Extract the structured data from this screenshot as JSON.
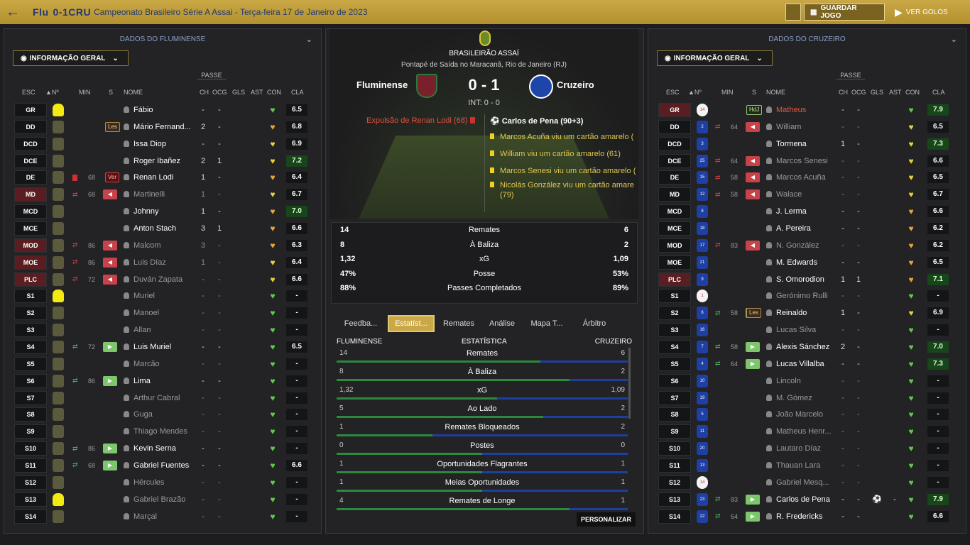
{
  "top": {
    "home_abbr": "Flu",
    "score": "0-1",
    "away_abbr": "CRU",
    "competition": "Campeonato Brasileiro Série A Assai - Terça-feira 17 de Janeiro de 2023",
    "save_label": "GUARDAR JOGO",
    "watch_label": "VER GOLOS"
  },
  "left": {
    "title": "DADOS DO FLUMINENSE",
    "info_label": "INFORMAÇÃO GERAL",
    "passe": "PASSE",
    "headers": {
      "esc": "ESC",
      "num": "Nº",
      "min": "MIN",
      "s": "S",
      "nome": "NOME",
      "ch": "CH",
      "ocg": "OCG",
      "gls": "GLS",
      "ast": "AST",
      "con": "CON",
      "cla": "CLA"
    },
    "players": [
      {
        "pos": "GR",
        "shirt": "y",
        "badge": "",
        "sub": "",
        "min": "",
        "name": "Fábio",
        "dim": false,
        "ch": "-",
        "ocg": "-",
        "gls": "",
        "ast": "",
        "con": "green",
        "cla": "6.5",
        "good": false
      },
      {
        "pos": "DD",
        "shirt": "n",
        "badge": "Les",
        "sub": "",
        "min": "",
        "name": "Mário Fernand...",
        "dim": false,
        "ch": "2",
        "ocg": "-",
        "gls": "",
        "ast": "",
        "con": "orange",
        "cla": "6.8",
        "good": false
      },
      {
        "pos": "DCD",
        "shirt": "n",
        "badge": "",
        "sub": "",
        "min": "",
        "name": "Issa Diop",
        "dim": false,
        "ch": "-",
        "ocg": "-",
        "gls": "",
        "ast": "",
        "con": "yellow",
        "cla": "6.9",
        "good": false
      },
      {
        "pos": "DCE",
        "shirt": "n",
        "badge": "",
        "sub": "",
        "min": "",
        "name": "Roger Ibañez",
        "dim": false,
        "ch": "2",
        "ocg": "1",
        "gls": "",
        "ast": "",
        "con": "yellow",
        "cla": "7.2",
        "good": true
      },
      {
        "pos": "DE",
        "shirt": "n",
        "badge": "Ver",
        "sub": "card",
        "min": "68",
        "name": "Renan Lodi",
        "dim": false,
        "ch": "1",
        "ocg": "-",
        "gls": "",
        "ast": "",
        "con": "orange",
        "cla": "6.4",
        "good": false
      },
      {
        "pos": "MD",
        "shirt": "n",
        "badge": "",
        "sub": "out",
        "min": "68",
        "name": "Martinelli",
        "dim": true,
        "ch": "1",
        "ocg": "-",
        "gls": "",
        "ast": "",
        "con": "yellow",
        "cla": "6.7",
        "good": false
      },
      {
        "pos": "MCD",
        "shirt": "n",
        "badge": "",
        "sub": "",
        "min": "",
        "name": "Johnny",
        "dim": false,
        "ch": "1",
        "ocg": "-",
        "gls": "",
        "ast": "",
        "con": "orange",
        "cla": "7.0",
        "good": true
      },
      {
        "pos": "MCE",
        "shirt": "n",
        "badge": "",
        "sub": "",
        "min": "",
        "name": "Anton Stach",
        "dim": false,
        "ch": "3",
        "ocg": "1",
        "gls": "",
        "ast": "",
        "con": "orange",
        "cla": "6.6",
        "good": false
      },
      {
        "pos": "MOD",
        "shirt": "n",
        "badge": "",
        "sub": "out",
        "min": "86",
        "name": "Malcom",
        "dim": true,
        "ch": "3",
        "ocg": "-",
        "gls": "",
        "ast": "",
        "con": "orange",
        "cla": "6.3",
        "good": false
      },
      {
        "pos": "MOE",
        "shirt": "n",
        "badge": "",
        "sub": "out",
        "min": "86",
        "name": "Luis Díaz",
        "dim": true,
        "ch": "1",
        "ocg": "-",
        "gls": "",
        "ast": "",
        "con": "yellow",
        "cla": "6.4",
        "good": false
      },
      {
        "pos": "PLC",
        "shirt": "n",
        "badge": "",
        "sub": "out",
        "min": "72",
        "name": "Duván Zapata",
        "dim": true,
        "ch": "-",
        "ocg": "-",
        "gls": "",
        "ast": "",
        "con": "yellow",
        "cla": "6.6",
        "good": false
      },
      {
        "pos": "S1",
        "shirt": "y",
        "badge": "",
        "sub": "",
        "min": "",
        "name": "Muriel",
        "dim": true,
        "ch": "-",
        "ocg": "-",
        "gls": "",
        "ast": "",
        "con": "green",
        "cla": "-",
        "good": false
      },
      {
        "pos": "S2",
        "shirt": "n",
        "badge": "",
        "sub": "",
        "min": "",
        "name": "Manoel",
        "dim": true,
        "ch": "-",
        "ocg": "-",
        "gls": "",
        "ast": "",
        "con": "green",
        "cla": "-",
        "good": false
      },
      {
        "pos": "S3",
        "shirt": "n",
        "badge": "",
        "sub": "",
        "min": "",
        "name": "Allan",
        "dim": true,
        "ch": "-",
        "ocg": "-",
        "gls": "",
        "ast": "",
        "con": "green",
        "cla": "-",
        "good": false
      },
      {
        "pos": "S4",
        "shirt": "n",
        "badge": "",
        "sub": "in",
        "min": "72",
        "name": "Luis Muriel",
        "dim": false,
        "ch": "-",
        "ocg": "-",
        "gls": "",
        "ast": "",
        "con": "green",
        "cla": "6.5",
        "good": false
      },
      {
        "pos": "S5",
        "shirt": "n",
        "badge": "",
        "sub": "",
        "min": "",
        "name": "Marcão",
        "dim": true,
        "ch": "-",
        "ocg": "-",
        "gls": "",
        "ast": "",
        "con": "green",
        "cla": "-",
        "good": false
      },
      {
        "pos": "S6",
        "shirt": "n",
        "badge": "",
        "sub": "in",
        "min": "86",
        "name": "Lima",
        "dim": false,
        "ch": "-",
        "ocg": "-",
        "gls": "",
        "ast": "",
        "con": "green",
        "cla": "-",
        "good": false
      },
      {
        "pos": "S7",
        "shirt": "n",
        "badge": "",
        "sub": "",
        "min": "",
        "name": "Arthur Cabral",
        "dim": true,
        "ch": "-",
        "ocg": "-",
        "gls": "",
        "ast": "",
        "con": "green",
        "cla": "-",
        "good": false
      },
      {
        "pos": "S8",
        "shirt": "n",
        "badge": "",
        "sub": "",
        "min": "",
        "name": "Guga",
        "dim": true,
        "ch": "-",
        "ocg": "-",
        "gls": "",
        "ast": "",
        "con": "green",
        "cla": "-",
        "good": false
      },
      {
        "pos": "S9",
        "shirt": "n",
        "badge": "",
        "sub": "",
        "min": "",
        "name": "Thiago Mendes",
        "dim": true,
        "ch": "-",
        "ocg": "-",
        "gls": "",
        "ast": "",
        "con": "green",
        "cla": "-",
        "good": false
      },
      {
        "pos": "S10",
        "shirt": "n",
        "badge": "",
        "sub": "in",
        "min": "86",
        "name": "Kevin Serna",
        "dim": false,
        "ch": "-",
        "ocg": "-",
        "gls": "",
        "ast": "",
        "con": "green",
        "cla": "-",
        "good": false
      },
      {
        "pos": "S11",
        "shirt": "n",
        "badge": "",
        "sub": "in",
        "min": "68",
        "name": "Gabriel Fuentes",
        "dim": false,
        "ch": "-",
        "ocg": "-",
        "gls": "",
        "ast": "",
        "con": "green",
        "cla": "6.6",
        "good": false
      },
      {
        "pos": "S12",
        "shirt": "n",
        "badge": "",
        "sub": "",
        "min": "",
        "name": "Hércules",
        "dim": true,
        "ch": "-",
        "ocg": "-",
        "gls": "",
        "ast": "",
        "con": "green",
        "cla": "-",
        "good": false
      },
      {
        "pos": "S13",
        "shirt": "y",
        "badge": "",
        "sub": "",
        "min": "",
        "name": "Gabriel Brazão",
        "dim": true,
        "ch": "-",
        "ocg": "-",
        "gls": "",
        "ast": "",
        "con": "green",
        "cla": "-",
        "good": false
      },
      {
        "pos": "S14",
        "shirt": "n",
        "badge": "",
        "sub": "",
        "min": "",
        "name": "Marçal",
        "dim": true,
        "ch": "-",
        "ocg": "-",
        "gls": "",
        "ast": "",
        "con": "green",
        "cla": "-",
        "good": false
      }
    ]
  },
  "right": {
    "title": "DADOS DO CRUZEIRO",
    "info_label": "INFORMAÇÃO GERAL",
    "passe": "PASSE",
    "headers": {
      "esc": "ESC",
      "num": "Nº",
      "min": "MIN",
      "s": "S",
      "nome": "NOME",
      "ch": "CH",
      "ocg": "OCG",
      "gls": "GLS",
      "ast": "AST",
      "con": "CON",
      "cla": "CLA"
    },
    "players": [
      {
        "pos": "GR",
        "shirt": "w",
        "num": "14",
        "badge": "HdJ",
        "sub": "",
        "min": "",
        "name": "Matheus",
        "dim": false,
        "red": true,
        "ch": "-",
        "ocg": "-",
        "gls": "",
        "ast": "",
        "con": "green",
        "cla": "7.9",
        "good": true
      },
      {
        "pos": "DD",
        "shirt": "b",
        "num": "2",
        "badge": "",
        "sub": "out",
        "min": "64",
        "name": "William",
        "dim": true,
        "ch": "-",
        "ocg": "-",
        "gls": "",
        "ast": "",
        "con": "yellow",
        "cla": "6.5",
        "good": false
      },
      {
        "pos": "DCD",
        "shirt": "b",
        "num": "3",
        "badge": "",
        "sub": "",
        "min": "",
        "name": "Tormena",
        "dim": false,
        "ch": "1",
        "ocg": "-",
        "gls": "",
        "ast": "",
        "con": "yellow",
        "cla": "7.3",
        "good": true
      },
      {
        "pos": "DCE",
        "shirt": "b",
        "num": "25",
        "badge": "",
        "sub": "out",
        "min": "64",
        "name": "Marcos Senesi",
        "dim": true,
        "ch": "-",
        "ocg": "-",
        "gls": "",
        "ast": "",
        "con": "yellow",
        "cla": "6.6",
        "good": false
      },
      {
        "pos": "DE",
        "shirt": "b",
        "num": "15",
        "badge": "",
        "sub": "out",
        "min": "58",
        "name": "Marcos Acuña",
        "dim": true,
        "ch": "-",
        "ocg": "-",
        "gls": "",
        "ast": "",
        "con": "yellow",
        "cla": "6.5",
        "good": false
      },
      {
        "pos": "MD",
        "shirt": "b",
        "num": "12",
        "badge": "",
        "sub": "out",
        "min": "58",
        "name": "Walace",
        "dim": true,
        "ch": "-",
        "ocg": "-",
        "gls": "",
        "ast": "",
        "con": "yellow",
        "cla": "6.7",
        "good": false
      },
      {
        "pos": "MCD",
        "shirt": "b",
        "num": "8",
        "badge": "",
        "sub": "",
        "min": "",
        "name": "J. Lerma",
        "dim": false,
        "ch": "-",
        "ocg": "-",
        "gls": "",
        "ast": "",
        "con": "orange",
        "cla": "6.6",
        "good": false
      },
      {
        "pos": "MCE",
        "shirt": "b",
        "num": "18",
        "badge": "",
        "sub": "",
        "min": "",
        "name": "A. Pereira",
        "dim": false,
        "ch": "-",
        "ocg": "-",
        "gls": "",
        "ast": "",
        "con": "orange",
        "cla": "6.2",
        "good": false
      },
      {
        "pos": "MOD",
        "shirt": "b",
        "num": "17",
        "badge": "",
        "sub": "out",
        "min": "83",
        "name": "N. González",
        "dim": true,
        "ch": "-",
        "ocg": "-",
        "gls": "",
        "ast": "",
        "con": "orange",
        "cla": "6.2",
        "good": false
      },
      {
        "pos": "MOE",
        "shirt": "b",
        "num": "21",
        "badge": "",
        "sub": "",
        "min": "",
        "name": "M. Edwards",
        "dim": false,
        "ch": "-",
        "ocg": "-",
        "gls": "",
        "ast": "",
        "con": "orange",
        "cla": "6.5",
        "good": false
      },
      {
        "pos": "PLC",
        "shirt": "b",
        "num": "9",
        "badge": "",
        "sub": "",
        "min": "",
        "name": "S. Omorodion",
        "dim": false,
        "ch": "1",
        "ocg": "1",
        "gls": "",
        "ast": "",
        "con": "orange",
        "cla": "7.1",
        "good": true
      },
      {
        "pos": "S1",
        "shirt": "w",
        "num": "1",
        "badge": "",
        "sub": "",
        "min": "",
        "name": "Gerónimo Rulli",
        "dim": true,
        "ch": "-",
        "ocg": "-",
        "gls": "",
        "ast": "",
        "con": "green",
        "cla": "-",
        "good": false
      },
      {
        "pos": "S2",
        "shirt": "b",
        "num": "6",
        "badge": "Les",
        "sub": "in",
        "min": "58",
        "name": "Reinaldo",
        "dim": false,
        "ch": "1",
        "ocg": "-",
        "gls": "",
        "ast": "",
        "con": "yellow",
        "cla": "6.9",
        "good": false
      },
      {
        "pos": "S3",
        "shirt": "b",
        "num": "16",
        "badge": "",
        "sub": "",
        "min": "",
        "name": "Lucas Silva",
        "dim": true,
        "ch": "-",
        "ocg": "-",
        "gls": "",
        "ast": "",
        "con": "green",
        "cla": "-",
        "good": false
      },
      {
        "pos": "S4",
        "shirt": "b",
        "num": "7",
        "badge": "",
        "sub": "in",
        "min": "58",
        "name": "Alexis Sánchez",
        "dim": false,
        "ch": "2",
        "ocg": "-",
        "gls": "",
        "ast": "",
        "con": "green",
        "cla": "7.0",
        "good": true
      },
      {
        "pos": "S5",
        "shirt": "b",
        "num": "4",
        "badge": "",
        "sub": "in",
        "min": "64",
        "name": "Lucas Villalba",
        "dim": false,
        "ch": "-",
        "ocg": "-",
        "gls": "",
        "ast": "",
        "con": "green",
        "cla": "7.3",
        "good": true
      },
      {
        "pos": "S6",
        "shirt": "b",
        "num": "10",
        "badge": "",
        "sub": "",
        "min": "",
        "name": "Lincoln",
        "dim": true,
        "ch": "-",
        "ocg": "-",
        "gls": "",
        "ast": "",
        "con": "green",
        "cla": "-",
        "good": false
      },
      {
        "pos": "S7",
        "shirt": "b",
        "num": "19",
        "badge": "",
        "sub": "",
        "min": "",
        "name": "M. Gómez",
        "dim": true,
        "ch": "-",
        "ocg": "-",
        "gls": "",
        "ast": "",
        "con": "green",
        "cla": "-",
        "good": false
      },
      {
        "pos": "S8",
        "shirt": "b",
        "num": "5",
        "badge": "",
        "sub": "",
        "min": "",
        "name": "João Marcelo",
        "dim": true,
        "ch": "-",
        "ocg": "-",
        "gls": "",
        "ast": "",
        "con": "green",
        "cla": "-",
        "good": false
      },
      {
        "pos": "S9",
        "shirt": "b",
        "num": "11",
        "badge": "",
        "sub": "",
        "min": "",
        "name": "Matheus Henr...",
        "dim": true,
        "ch": "-",
        "ocg": "-",
        "gls": "",
        "ast": "",
        "con": "green",
        "cla": "-",
        "good": false
      },
      {
        "pos": "S10",
        "shirt": "b",
        "num": "20",
        "badge": "",
        "sub": "",
        "min": "",
        "name": "Lautaro Díaz",
        "dim": true,
        "ch": "-",
        "ocg": "-",
        "gls": "",
        "ast": "",
        "con": "green",
        "cla": "-",
        "good": false
      },
      {
        "pos": "S11",
        "shirt": "b",
        "num": "13",
        "badge": "",
        "sub": "",
        "min": "",
        "name": "Thauan Lara",
        "dim": true,
        "ch": "-",
        "ocg": "-",
        "gls": "",
        "ast": "",
        "con": "green",
        "cla": "-",
        "good": false
      },
      {
        "pos": "S12",
        "shirt": "w",
        "num": "14",
        "badge": "",
        "sub": "",
        "min": "",
        "name": "Gabriel Mesq...",
        "dim": true,
        "ch": "-",
        "ocg": "-",
        "gls": "",
        "ast": "",
        "con": "green",
        "cla": "-",
        "good": false
      },
      {
        "pos": "S13",
        "shirt": "b",
        "num": "23",
        "badge": "",
        "sub": "in",
        "min": "83",
        "name": "Carlos de Pena",
        "dim": false,
        "ch": "-",
        "ocg": "-",
        "gls": "⚽",
        "ast": "-",
        "con": "green",
        "cla": "7.9",
        "good": true
      },
      {
        "pos": "S14",
        "shirt": "b",
        "num": "22",
        "badge": "",
        "sub": "in",
        "min": "64",
        "name": "R. Fredericks",
        "dim": false,
        "ch": "-",
        "ocg": "-",
        "gls": "",
        "ast": "",
        "con": "green",
        "cla": "6.6",
        "good": false
      }
    ]
  },
  "match": {
    "league": "BRASILEIRÃO ASSAÍ",
    "kickoff": "Pontapé de Saída no Maracanã, Rio de Janeiro (RJ)",
    "home": "Fluminense",
    "away": "Cruzeiro",
    "score": "0 - 1",
    "ht": "INT: 0 - 0",
    "home_event": "Expulsão de Renan Lodi (68)",
    "away_events": [
      "Carlos de Pena (90+3)",
      "Marcos Acuña viu um cartão amarelo (",
      "William viu um cartão amarelo (61)",
      "Marcos Senesi viu um cartão amarelo (",
      "Nicolás González viu um cartão amare",
      "(79)"
    ]
  },
  "summary": [
    {
      "l": "14",
      "m": "Remates",
      "r": "6"
    },
    {
      "l": "8",
      "m": "À Baliza",
      "r": "2"
    },
    {
      "l": "1,32",
      "m": "xG",
      "r": "1,09"
    },
    {
      "l": "47%",
      "m": "Posse",
      "r": "53%"
    },
    {
      "l": "88%",
      "m": "Passes Completados",
      "r": "89%"
    }
  ],
  "tabs": [
    "Feedba...",
    "Estatíst...",
    "Remates",
    "Análise",
    "Mapa T...",
    "Árbitro"
  ],
  "comparison": {
    "home": "FLUMINENSE",
    "title": "ESTATÍSTICA",
    "away": "CRUZEIRO",
    "customize": "PERSONALIZAR",
    "rows": [
      {
        "l": "14",
        "m": "Remates",
        "r": "6",
        "share": 0.7
      },
      {
        "l": "8",
        "m": "À Baliza",
        "r": "2",
        "share": 0.8
      },
      {
        "l": "1,32",
        "m": "xG",
        "r": "1,09",
        "share": 0.55
      },
      {
        "l": "5",
        "m": "Ao Lado",
        "r": "2",
        "share": 0.71
      },
      {
        "l": "1",
        "m": "Remates Bloqueados",
        "r": "2",
        "share": 0.33
      },
      {
        "l": "0",
        "m": "Postes",
        "r": "0",
        "share": 0.5
      },
      {
        "l": "1",
        "m": "Oportunidades Flagrantes",
        "r": "1",
        "share": 0.5
      },
      {
        "l": "1",
        "m": "Meias Oportunidades",
        "r": "1",
        "share": 0.5
      },
      {
        "l": "4",
        "m": "Remates de Longe",
        "r": "1",
        "share": 0.8
      }
    ]
  },
  "colors": {
    "gold": "#c9a845",
    "green": "#2b8a3e",
    "blue": "#1f3f9f",
    "sub_out": "#c8424a",
    "sub_in": "#7dc66b"
  }
}
